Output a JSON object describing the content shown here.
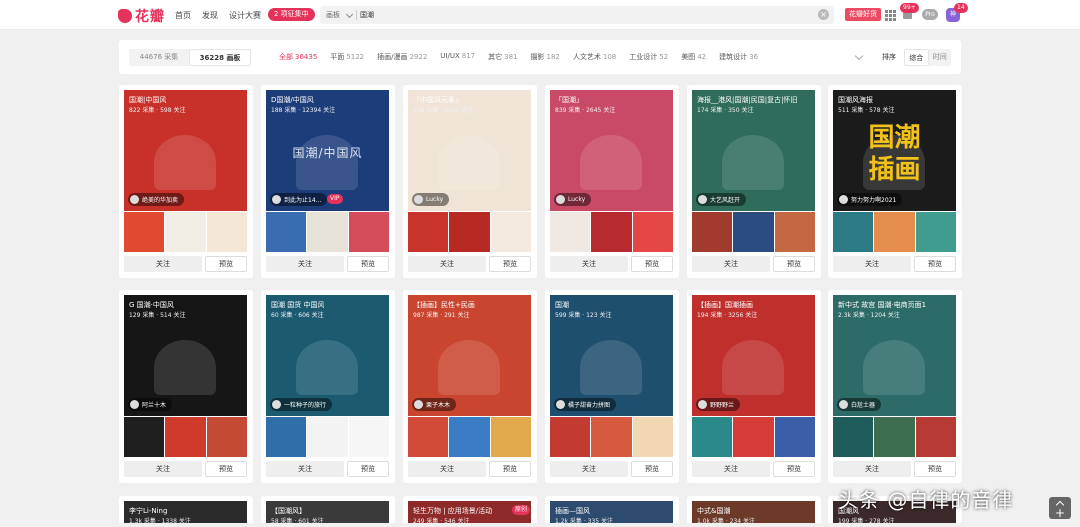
{
  "header": {
    "logo_text": "花瓣",
    "nav": [
      "首页",
      "发现",
      "设计大赛"
    ],
    "collect_pill": "2 项征集中",
    "search": {
      "scope": "画板",
      "value": "国潮",
      "placeholder": ""
    },
    "hot_button": "花瓣好货",
    "notification_count": "99+",
    "pro_label": "Pro",
    "avatar_label": "神",
    "avatar_badge": "14"
  },
  "filter": {
    "tabs": [
      {
        "label": "44676 采集",
        "active": false
      },
      {
        "label": "36228 画板",
        "active": true
      }
    ],
    "categories": [
      {
        "name": "全部",
        "count": "36435",
        "active": true
      },
      {
        "name": "平面",
        "count": "5122",
        "active": false
      },
      {
        "name": "插画/漫画",
        "count": "2922",
        "active": false
      },
      {
        "name": "UI/UX",
        "count": "817",
        "active": false
      },
      {
        "name": "其它",
        "count": "381",
        "active": false
      },
      {
        "name": "摄影",
        "count": "182",
        "active": false
      },
      {
        "name": "人文艺术",
        "count": "108",
        "active": false
      },
      {
        "name": "工业设计",
        "count": "52",
        "active": false
      },
      {
        "name": "美图",
        "count": "42",
        "active": false
      },
      {
        "name": "建筑设计",
        "count": "36",
        "active": false
      }
    ],
    "sort_label": "排序",
    "sort_options": [
      {
        "label": "综合",
        "active": true
      },
      {
        "label": "时间",
        "active": false
      }
    ]
  },
  "boards": [
    {
      "title": "国潮|中国风",
      "stats": "822 采集 · 598 关注",
      "owner": "绝美的华加卖",
      "cover": "#c8312a",
      "thumbs": [
        "#e14a2e",
        "#f2eee5",
        "#f5e7d8"
      ]
    },
    {
      "title": "D国潮/中国风",
      "stats": "188 采集 · 12394 关注",
      "owner": "到此为止14...",
      "tag": "VIP",
      "cover": "#1d3c7a",
      "big": "国潮/中国风",
      "thumbs": [
        "#3a6cb0",
        "#e8e3d8",
        "#d54c5a"
      ]
    },
    {
      "title": "「中国风元素」",
      "stats": "628 采集 · 3052 关注",
      "owner": "Lucky",
      "cover": "#efe4d6",
      "thumbs": [
        "#c8332b",
        "#b72a24",
        "#f3e9de"
      ]
    },
    {
      "title": "「国潮」",
      "stats": "839 采集 · 2645 关注",
      "owner": "Lucky",
      "cover": "#c94a66",
      "thumbs": [
        "#f0e8e2",
        "#b62a30",
        "#e54646"
      ]
    },
    {
      "title": "海报__港风|国潮|民国|复古|怀旧",
      "stats": "174 采集 · 350 关注",
      "owner": "大艺风赶开",
      "cover": "#2f6c5b",
      "thumbs": [
        "#a03b2d",
        "#2a4c80",
        "#c46844"
      ]
    },
    {
      "title": "国潮风海报",
      "stats": "511 采集 · 578 关注",
      "owner": "努力努力啊2021",
      "cover": "#1b1b1b",
      "big": "国潮\n插画",
      "thumbs": [
        "#2c7a86",
        "#e58d4c",
        "#3f9c8f"
      ]
    },
    {
      "title": "G 国潮·中国风",
      "stats": "129 采集 · 514 关注",
      "owner": "阿兰十木",
      "cover": "#161616",
      "thumbs": [
        "#1f1f1f",
        "#cf3a2b",
        "#c44a35"
      ]
    },
    {
      "title": "国潮 国货 中国风",
      "stats": "60 采集 · 606 关注",
      "owner": "一粒种子的旅行",
      "cover": "#1c5a70",
      "thumbs": [
        "#2f6ea8",
        "#f3f3f3",
        "#f6f6f6"
      ]
    },
    {
      "title": "【插画】民性+民画",
      "stats": "987 采集 · 291 关注",
      "owner": "栗子木木",
      "cover": "#c9452f",
      "thumbs": [
        "#d24b3a",
        "#3b7dc4",
        "#e2a84c"
      ]
    },
    {
      "title": "国潮",
      "stats": "599 采集 · 123 关注",
      "owner": "橘子甜奋力拼图",
      "cover": "#1e4f6e",
      "thumbs": [
        "#c33a31",
        "#d55a40",
        "#f2d7b3"
      ]
    },
    {
      "title": "【插画】国潮插画",
      "stats": "194 采集 · 3256 关注",
      "owner": "野野野兰",
      "cover": "#bf2f2c",
      "thumbs": [
        "#2a8a8a",
        "#d63d38",
        "#3a5fa8"
      ]
    },
    {
      "title": "新中式 故宫 国潮·电商页面1",
      "stats": "2.3k 采集 · 1204 关注",
      "owner": "白尬土器",
      "cover": "#2c6b68",
      "thumbs": [
        "#1f5c5c",
        "#3c6e4f",
        "#b73a34"
      ]
    }
  ],
  "bottom_boards": [
    {
      "title": "李宁Li-Ning",
      "stats": "1.3k 采集 · 1338 关注",
      "cover": "#2b2b2b"
    },
    {
      "title": "【国潮风】",
      "stats": "58 采集 · 601 关注",
      "cover": "#3a3a3a"
    },
    {
      "title": "轻生万物 | 应用场景/活动",
      "stats": "249 采集 · 546 关注",
      "cover": "#8e2a2a",
      "tag": "原创"
    },
    {
      "title": "插画—国风",
      "stats": "1.2k 采集 · 335 关注",
      "cover": "#2d4b6e"
    },
    {
      "title": "中式&国潮",
      "stats": "1.0k 采集 · 234 关注",
      "cover": "#6d3a2a"
    },
    {
      "title": "国潮风",
      "stats": "199 采集 · 278 关注",
      "cover": "#3c2a2a"
    }
  ],
  "card_buttons": {
    "follow": "关注",
    "preview": "预览"
  },
  "watermark": "头条 @自律的音律"
}
